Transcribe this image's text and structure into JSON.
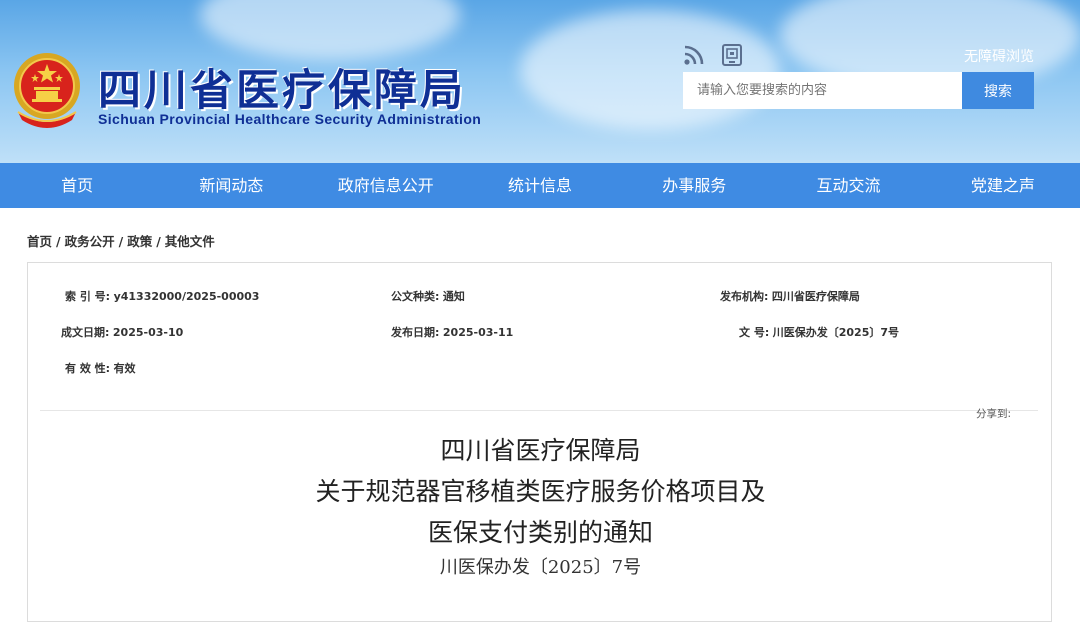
{
  "header": {
    "title_cn": "四川省医疗保障局",
    "title_en": "Sichuan Provincial Healthcare Security Administration",
    "accessibility_label": "无障碍浏览",
    "search_placeholder": "请输入您要搜索的内容",
    "search_button": "搜索",
    "icons": [
      "rss-icon",
      "mobile-qr-icon"
    ],
    "brand_color": "#0f2f95"
  },
  "nav": {
    "items": [
      "首页",
      "新闻动态",
      "政府信息公开",
      "统计信息",
      "办事服务",
      "互动交流",
      "党建之声"
    ],
    "color": "#3f8be3"
  },
  "breadcrumb": {
    "items": [
      "首页",
      "政务公开",
      "政策",
      "其他文件"
    ],
    "separator": "/"
  },
  "meta": {
    "index_label": "索 引 号:",
    "index_value": "y41332000/2025-00003",
    "type_label": "公文种类:",
    "type_value": "通知",
    "issuer_label": "发布机构:",
    "issuer_value": "四川省医疗保障局",
    "created_label": "成文日期:",
    "created_value": "2025-03-10",
    "published_label": "发布日期:",
    "published_value": "2025-03-11",
    "docno_label": "文 号:",
    "docno_value": "川医保办发〔2025〕7号",
    "validity_label": "有 效 性:",
    "validity_value": "有效"
  },
  "share_label": "分享到:",
  "document": {
    "title_line1": "四川省医疗保障局",
    "title_line2": "关于规范器官移植类医疗服务价格项目及",
    "title_line3": "医保支付类别的通知",
    "doc_number": "川医保办发〔2025〕7号"
  }
}
